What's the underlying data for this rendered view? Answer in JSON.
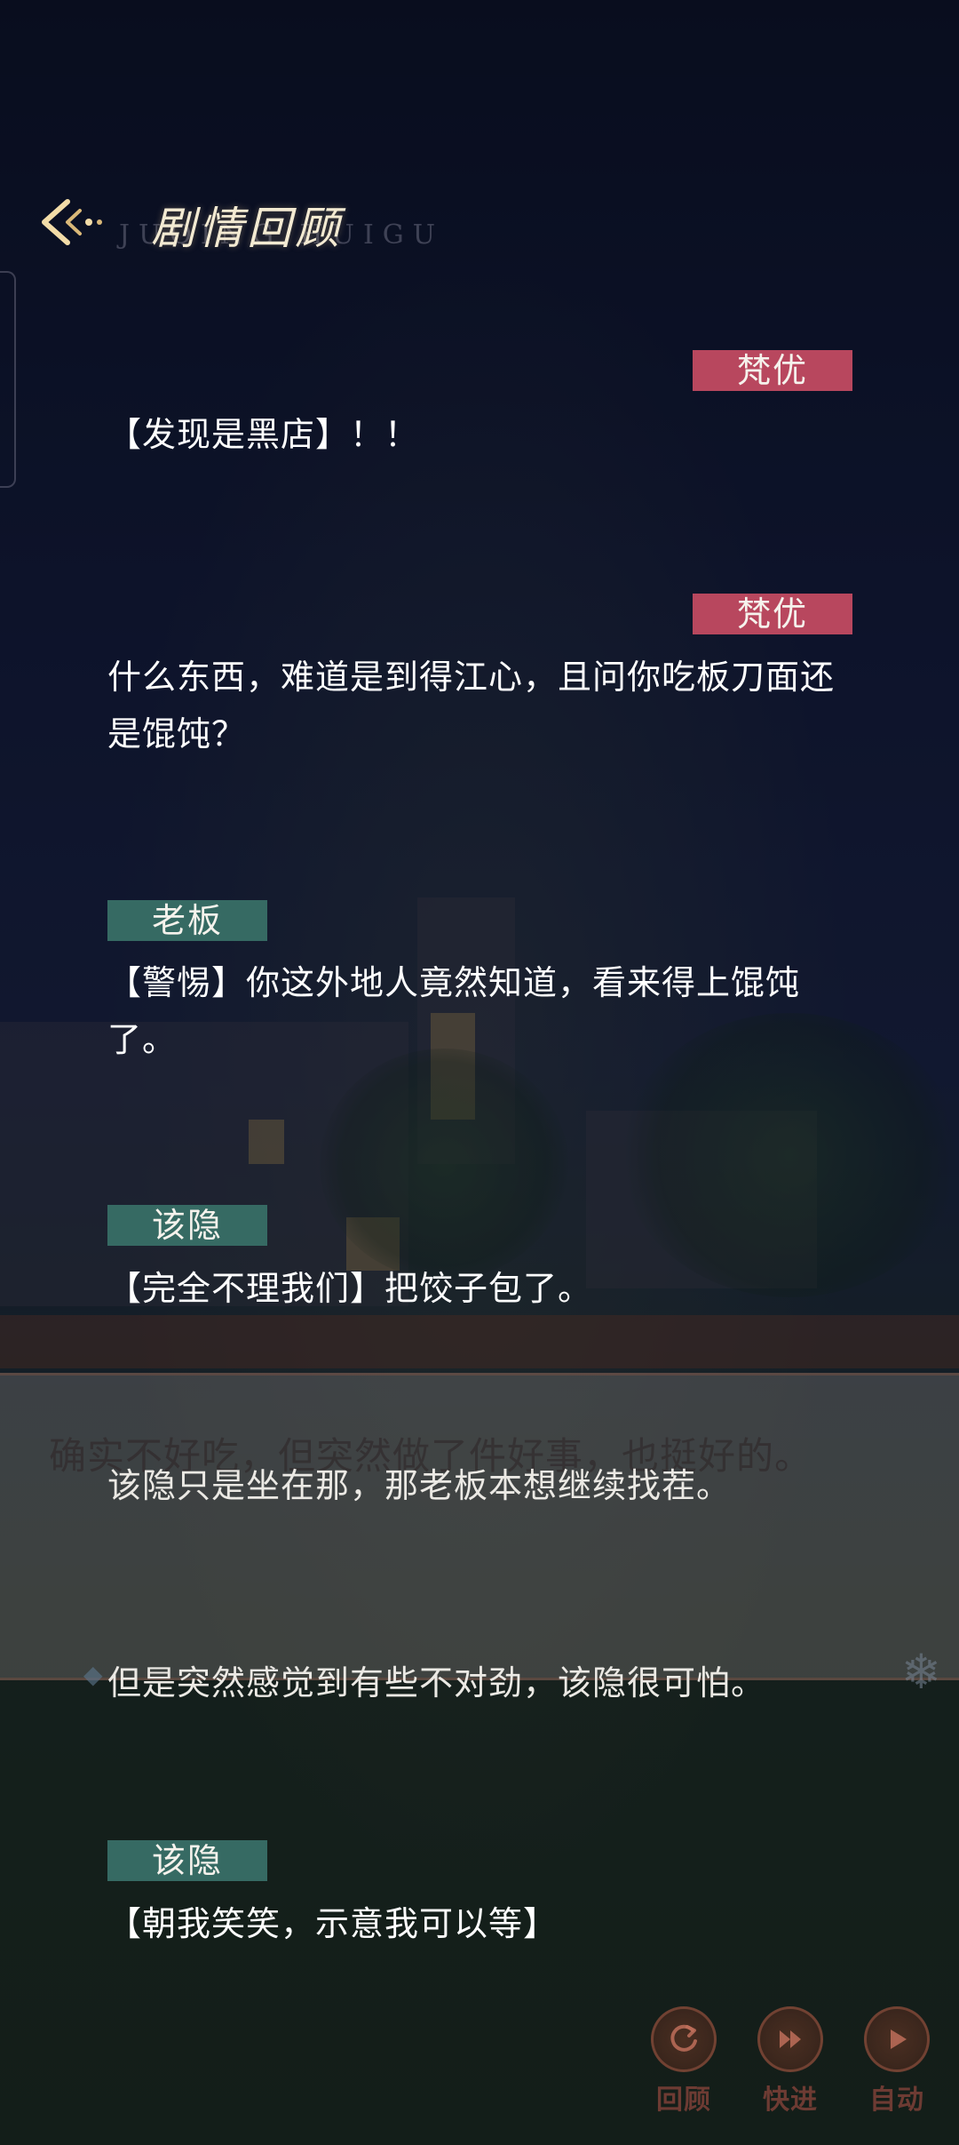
{
  "header": {
    "title": "剧情回顾",
    "subtitle": "JUQING HUIGU"
  },
  "background": {
    "dialog_text": "确实不好吃，但突然做了件好事，也挺好的。"
  },
  "log": [
    {
      "speaker": "梵优",
      "text": "【发现是黑店】！！"
    },
    {
      "speaker": "梵优",
      "text": "什么东西，难道是到得江心，且问你吃板刀面还是馄饨？"
    },
    {
      "speaker": "老板",
      "text": "【警惕】你这外地人竟然知道，看来得上馄饨了。"
    },
    {
      "speaker": "该隐",
      "text": "【完全不理我们】把饺子包了。"
    },
    {
      "speaker": "",
      "text": "该隐只是坐在那，那老板本想继续找茬。"
    },
    {
      "speaker": "",
      "text": "但是突然感觉到有些不对劲，该隐很可怕。"
    },
    {
      "speaker": "该隐",
      "text": "【朝我笑笑，示意我可以等】"
    }
  ],
  "controls": {
    "review": "回顾",
    "skip": "快进",
    "auto": "自动"
  },
  "colors": {
    "player_tag": "#b8475e",
    "npc_tag": "#366a63",
    "title": "#f3ead2"
  },
  "icons": {
    "back": "back-arrow-icon",
    "review": "rewind-icon",
    "skip": "fast-forward-icon",
    "auto": "play-icon"
  }
}
